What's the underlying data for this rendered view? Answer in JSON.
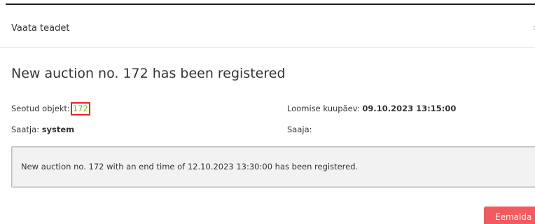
{
  "modal": {
    "title": "Vaata teadet"
  },
  "notice": {
    "headline": "New auction no. 172 has been registered",
    "linked_object_label": "Seotud objekt:",
    "linked_object_value": "172",
    "created_label": "Loomise kuupäev:",
    "created_value": "09.10.2023 13:15:00",
    "sender_label": "Saatja:",
    "sender_value": "system",
    "recipient_label": "Saaja:",
    "recipient_value": "",
    "message": "New auction no. 172 with an end time of 12.10.2023 13:30:00 has been registered."
  },
  "actions": {
    "delete_label": "Eemalda"
  },
  "colors": {
    "link": "#7ab317",
    "link_highlight_border": "#e32626",
    "delete_button": "#f25a5f"
  }
}
